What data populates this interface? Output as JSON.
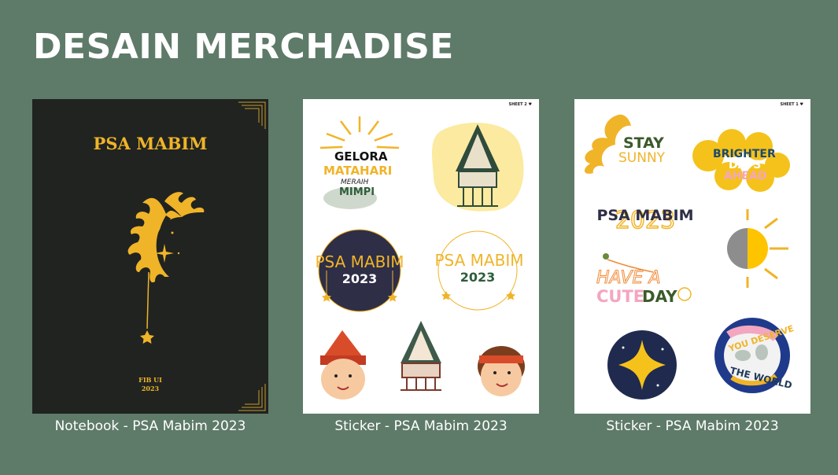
{
  "slide": {
    "title": "DESAIN MERCHADISE"
  },
  "items": [
    {
      "caption": "Notebook - PSA Mabim 2023",
      "cover_title": "PSA MABIM",
      "cover_footer_line1": "FIB UI",
      "cover_footer_line2": "2023"
    },
    {
      "caption": "Sticker - PSA Mabim 2023",
      "sheet_label": "SHEET 2 ♥",
      "stickers": {
        "gelora_1": "GELORA",
        "gelora_2": "MATAHARI",
        "gelora_3": "MERAIH",
        "gelora_4": "MIMPI",
        "badge_a_title": "PSA MABIM",
        "badge_a_year": "2023",
        "badge_b_title": "PSA MABIM",
        "badge_b_year": "2023"
      }
    },
    {
      "caption": "Sticker - PSA Mabim 2023",
      "sheet_label": "SHEET 1 ♥",
      "stickers": {
        "stay_1": "STAY",
        "stay_2": "SUNNY",
        "brighter_1": "BRIGHTER",
        "brighter_2": "DAYS",
        "brighter_3": "AHEAD",
        "psa_title": "PSA MABIM",
        "psa_year": "2023",
        "cute_1": "HAVE A",
        "cute_2": "CUTE",
        "cute_3": "DAY",
        "world_1": "YOU DESERVE",
        "world_2": "THE WORLD"
      }
    }
  ],
  "colors": {
    "background": "#5e7a68",
    "gold": "#f0b429",
    "cover": "#202320"
  }
}
